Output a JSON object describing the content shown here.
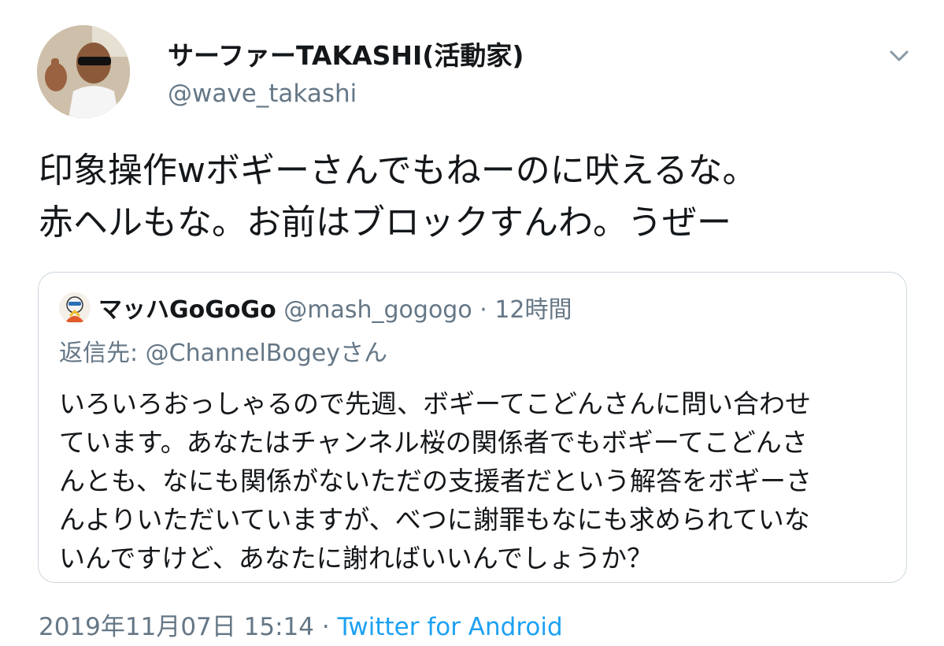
{
  "author": {
    "name": "サーファーTAKASHI(活動家)",
    "handle": "@wave_takashi"
  },
  "tweet": {
    "lines": [
      "印象操作wボギーさんでもねーのに吠えるな。",
      "赤ヘルもな。お前はブロックすんわ。うぜー"
    ]
  },
  "quoted": {
    "name": "マッハGoGoGo",
    "handle": "@mash_gogogo",
    "dot": "·",
    "time": "12時間",
    "reply_to": "返信先: @ChannelBogeyさん",
    "lines": [
      "いろいろおっしゃるので先週、ボギーてこどんさんに問い合わせ",
      "ています。あなたはチャンネル桜の関係者でもボギーてこどんさ",
      "んとも、なにも関係がないただの支援者だという解答をボギーさ",
      "んよりいただいていますが、べつに謝罪もなにも求められていな",
      "いんですけど、あなたに謝ればいいんでしょうか？"
    ]
  },
  "footer": {
    "date": "2019年11月07日 15:14",
    "dot": "·",
    "source": "Twitter for Android"
  },
  "icons": {
    "avatar": "avatar-photo",
    "caret": "chevron-down-icon",
    "quoted_avatar": "avatar-photo"
  },
  "colors": {
    "text": "#14171a",
    "secondary": "#657786",
    "link": "#1da1f2",
    "border": "#ccd6dd"
  }
}
